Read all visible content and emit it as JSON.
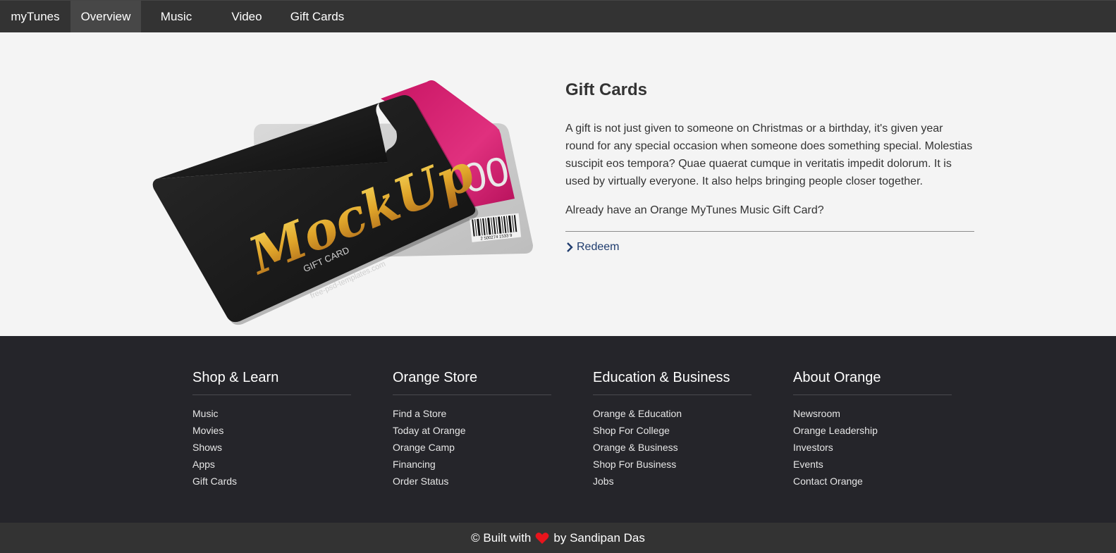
{
  "nav": {
    "brand": "myTunes",
    "items": [
      {
        "label": "Overview",
        "active": true
      },
      {
        "label": "Music",
        "active": false
      },
      {
        "label": "Video",
        "active": false
      },
      {
        "label": "Gift Cards",
        "active": false
      }
    ]
  },
  "hero": {
    "image": {
      "front_brand": "MockUp",
      "front_subtitle": "GIFT CARD",
      "front_url": "free-psd-templates.com",
      "back_amount": "00",
      "barcode_number": "2 500274 1533 9"
    },
    "title": "Gift Cards",
    "description": "A gift is not just given to someone on Christmas or a birthday, it's given year round for any special occasion when someone does something special. Molestias suscipit eos tempora? Quae quaerat cumque in veritatis impedit dolorum. It is used by virtually everyone. It also helps bringing people closer together.",
    "question": "Already have an Orange MyTunes Music Gift Card?",
    "redeem_label": "Redeem"
  },
  "footer": {
    "columns": [
      {
        "title": "Shop & Learn",
        "links": [
          "Music",
          "Movies",
          "Shows",
          "Apps",
          "Gift Cards"
        ]
      },
      {
        "title": "Orange Store",
        "links": [
          "Find a Store",
          "Today at Orange",
          "Orange Camp",
          "Financing",
          "Order Status"
        ]
      },
      {
        "title": "Education & Business",
        "links": [
          "Orange & Education",
          "Shop For College",
          "Orange & Business",
          "Shop For Business",
          "Jobs"
        ]
      },
      {
        "title": "About Orange",
        "links": [
          "Newsroom",
          "Orange Leadership",
          "Investors",
          "Events",
          "Contact Orange"
        ]
      }
    ],
    "credit_prefix": "© Built with",
    "credit_suffix": "by Sandipan Das"
  },
  "colors": {
    "navbar": "#333333",
    "nav_active": "#474747",
    "page_bg": "#f4f4f4",
    "footer_bg": "#25252a",
    "link_blue": "#1f3c6e",
    "heart": "#e8141c",
    "card_pink": "#d4176b"
  }
}
